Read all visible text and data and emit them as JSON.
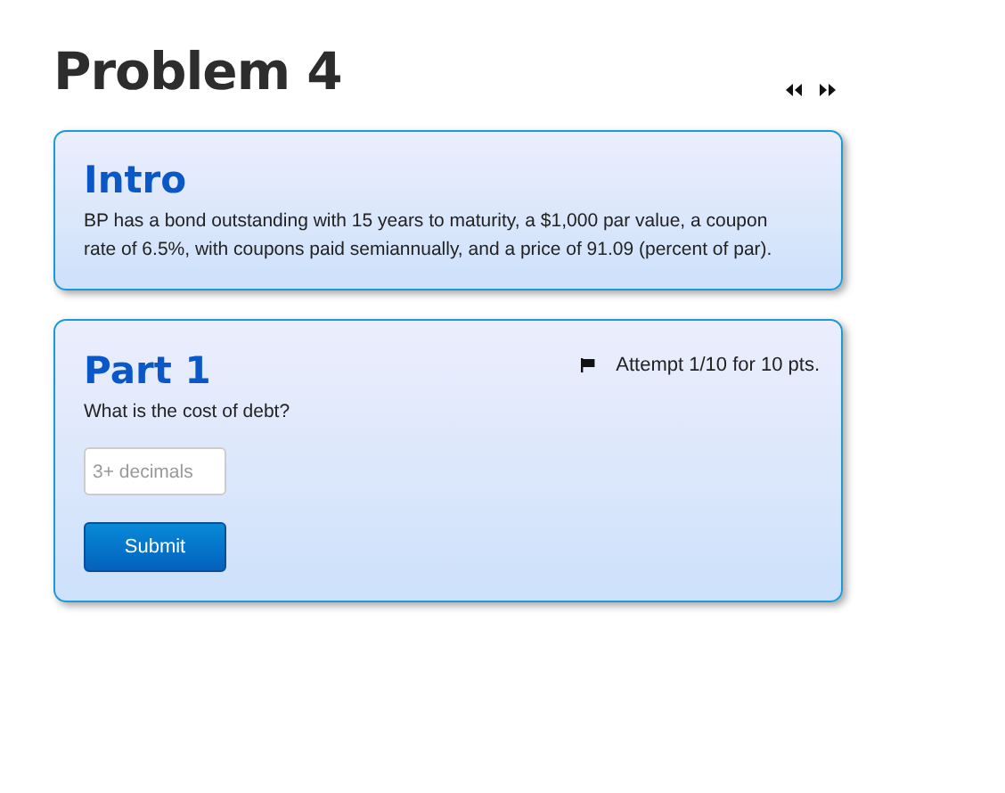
{
  "page": {
    "title": "Problem 4"
  },
  "intro": {
    "heading": "Intro",
    "text": "BP has a bond outstanding with 15 years to maturity, a $1,000 par value, a coupon rate of 6.5%, with coupons paid semiannually, and a price of 91.09 (percent of par)."
  },
  "part": {
    "heading": "Part 1",
    "attempt": "Attempt 1/10 for 10 pts.",
    "question": "What is the cost of debt?",
    "answer": {
      "placeholder": "3+ decimals"
    },
    "button": "Submit"
  }
}
